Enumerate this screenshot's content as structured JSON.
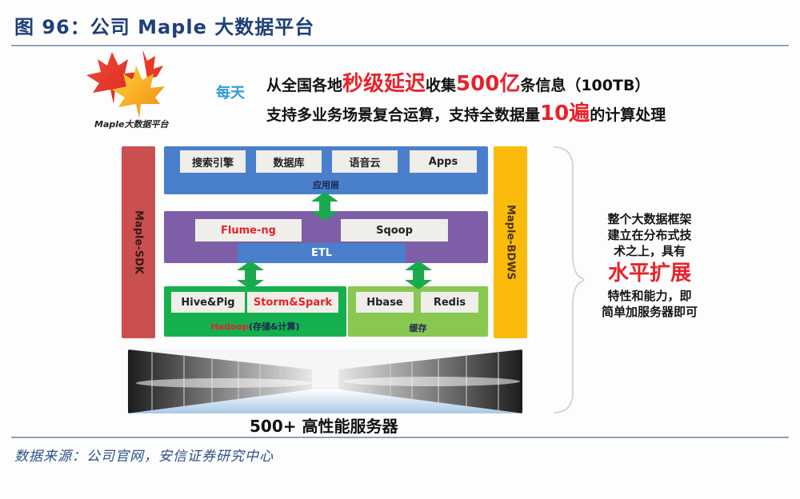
{
  "figure": {
    "title": "图 96：公司 Maple 大数据平台",
    "source": "数据来源：公司官网，安信证券研究中心"
  },
  "logo": {
    "icon": "maple-leaf-icon",
    "caption": "Maple大数据平台"
  },
  "headline": {
    "prefix": "每天",
    "line1": {
      "part1": "从全国各地",
      "highlight1": "秒级延迟",
      "part2": "收集",
      "highlight2": "500亿",
      "part3": "条信息（100TB）"
    },
    "line2": {
      "part1": "支持多业务场景复合运算，支持全数据量",
      "highlight": "10遍",
      "part2": "的计算处理"
    }
  },
  "diagram": {
    "left_bar": "Maple-SDK",
    "right_bar": "Maple-BDWS",
    "application_layer": {
      "label": "应用层",
      "items": [
        "搜索引擎",
        "数据库",
        "语音云",
        "Apps"
      ]
    },
    "etl_layer": {
      "items": [
        {
          "label": "Flume-ng",
          "color": "#e8222a"
        },
        {
          "label": "Sqoop",
          "color": "#222222"
        }
      ],
      "bar_label": "ETL"
    },
    "hadoop_layer": {
      "label_highlight": "Hadoop",
      "label_rest": "(存储&计算)",
      "items": [
        {
          "label": "Hive&Pig",
          "color": "#222222"
        },
        {
          "label": "Storm&Spark",
          "color": "#e8222a"
        }
      ]
    },
    "cache_layer": {
      "label": "缓存",
      "items": [
        "Hbase",
        "Redis"
      ]
    },
    "connector_icon": "double-arrow-icon",
    "servers_caption": "500+ 高性能服务器"
  },
  "side_note": {
    "line1": "整个大数据框架",
    "line2": "建立在分布式技",
    "line3": "术之上，具有",
    "highlight": "水平扩展",
    "line4": "特性和能力，即",
    "line5": "简单加服务器即可"
  },
  "colors": {
    "title_blue": "#1f3f7a",
    "accent_red": "#e8222a",
    "app_blue": "#4a7fcb",
    "etl_purple": "#7d5ea7",
    "hadoop_green": "#15b04e",
    "cache_green": "#88c850",
    "sdk_red": "#c9504f",
    "bdws_yellow": "#fbbb0c",
    "arrow_green": "#1aa94c"
  }
}
